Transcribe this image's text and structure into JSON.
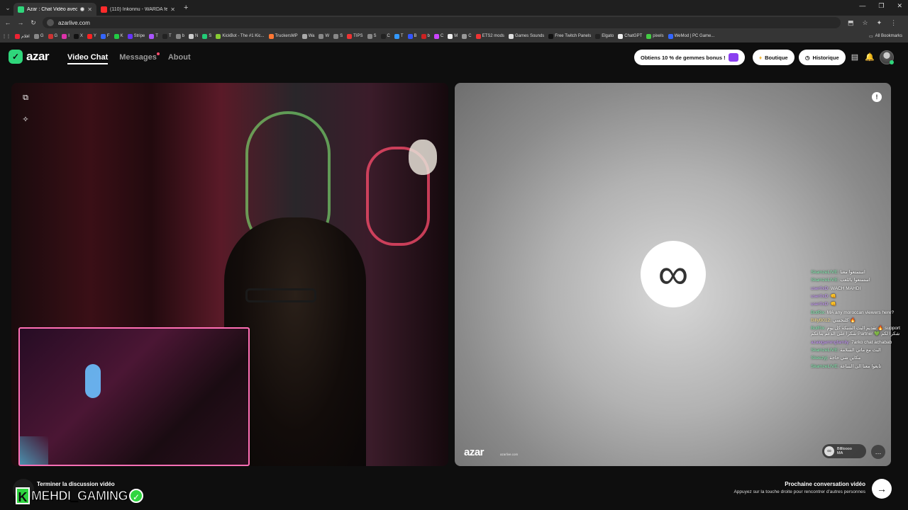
{
  "browser": {
    "tabs": [
      {
        "title": "Azar : Chat Vidéo avec de...",
        "active": true
      },
      {
        "title": "(110) Inkonnu - WARDA feat M...",
        "active": false
      }
    ],
    "url": "azarlive.com",
    "bookmarks": [
      "اقلام",
      "G",
      "G",
      "I",
      "X",
      "Y",
      "F",
      "K",
      "Stripe",
      "T",
      "T",
      "b",
      "N",
      "S",
      "KickBot - The #1 Kic...",
      "TruckersMP",
      "Wa",
      "W",
      "S",
      "TIPS",
      "S",
      "C",
      "T",
      "B",
      "b",
      "C",
      "M",
      "C",
      "ETS2 mods",
      "Games Sounds",
      "Free Twitch Panels",
      "Elgato",
      "ChatGPT",
      "pixels",
      "WeMod | PC Game..."
    ],
    "all_bookmarks_label": "All Bookmarks"
  },
  "app": {
    "logo_text": "azar",
    "nav": [
      {
        "label": "Video Chat",
        "active": true
      },
      {
        "label": "Messages",
        "active": false,
        "dot": true
      },
      {
        "label": "About",
        "active": false
      }
    ],
    "promo_label": "Obtiens 10 % de gemmes bonus !",
    "shop_label": "Boutique",
    "history_label": "Historique"
  },
  "right_video": {
    "watermark": "azar",
    "watermark_sub": "azarlive.com"
  },
  "chat": [
    {
      "user": "SkamzeLIVE:",
      "msg": "استمتعوا معنا",
      "color": "green"
    },
    {
      "user": "SkamzeLIVE:",
      "msg": "استمتعوا باللعب",
      "color": "green"
    },
    {
      "user": "user0xD:",
      "msg": "WACH MAHDI",
      "color": "purple"
    },
    {
      "user": "user0xD:",
      "msg": "👊",
      "color": "purple"
    },
    {
      "user": "user0xD:",
      "msg": "👊",
      "color": "purple"
    },
    {
      "user": "BotRix:",
      "msg": "MA any moroccan viewers here?",
      "color": "green"
    },
    {
      "user": "BillyB012:",
      "msg": "كلنجسي 🔥",
      "color": "yellow"
    },
    {
      "user": "BotRix:",
      "msg": "تقديم البث الشبكة كل يوم 🔥 support شكرا على الدعم بتاعكم Partner 💚 شكرا لكم",
      "color": "green"
    },
    {
      "user": "azakigamingfamily:",
      "msg": "7arko chat achabab",
      "color": "purple"
    },
    {
      "user": "SkamzeLIVE:",
      "msg": "البث مع ماتي السلامة",
      "color": "green"
    },
    {
      "user": "Skeezyj:",
      "msg": "مكاين شي حاجة",
      "color": "green"
    },
    {
      "user": "SkamzeLIVE:",
      "msg": "تابعوا معنا الى الساعة",
      "color": "green"
    }
  ],
  "partner": {
    "name": "Blllloooo",
    "country": "MA"
  },
  "footer": {
    "end_call_label": "Terminer la discussion vidéo",
    "streamer_name": "MEHDI_GAMING",
    "next_title": "Prochaine conversation vidéo",
    "next_sub": "Appuyez sur la touche droite pour rencontrer d'autres personnes"
  }
}
